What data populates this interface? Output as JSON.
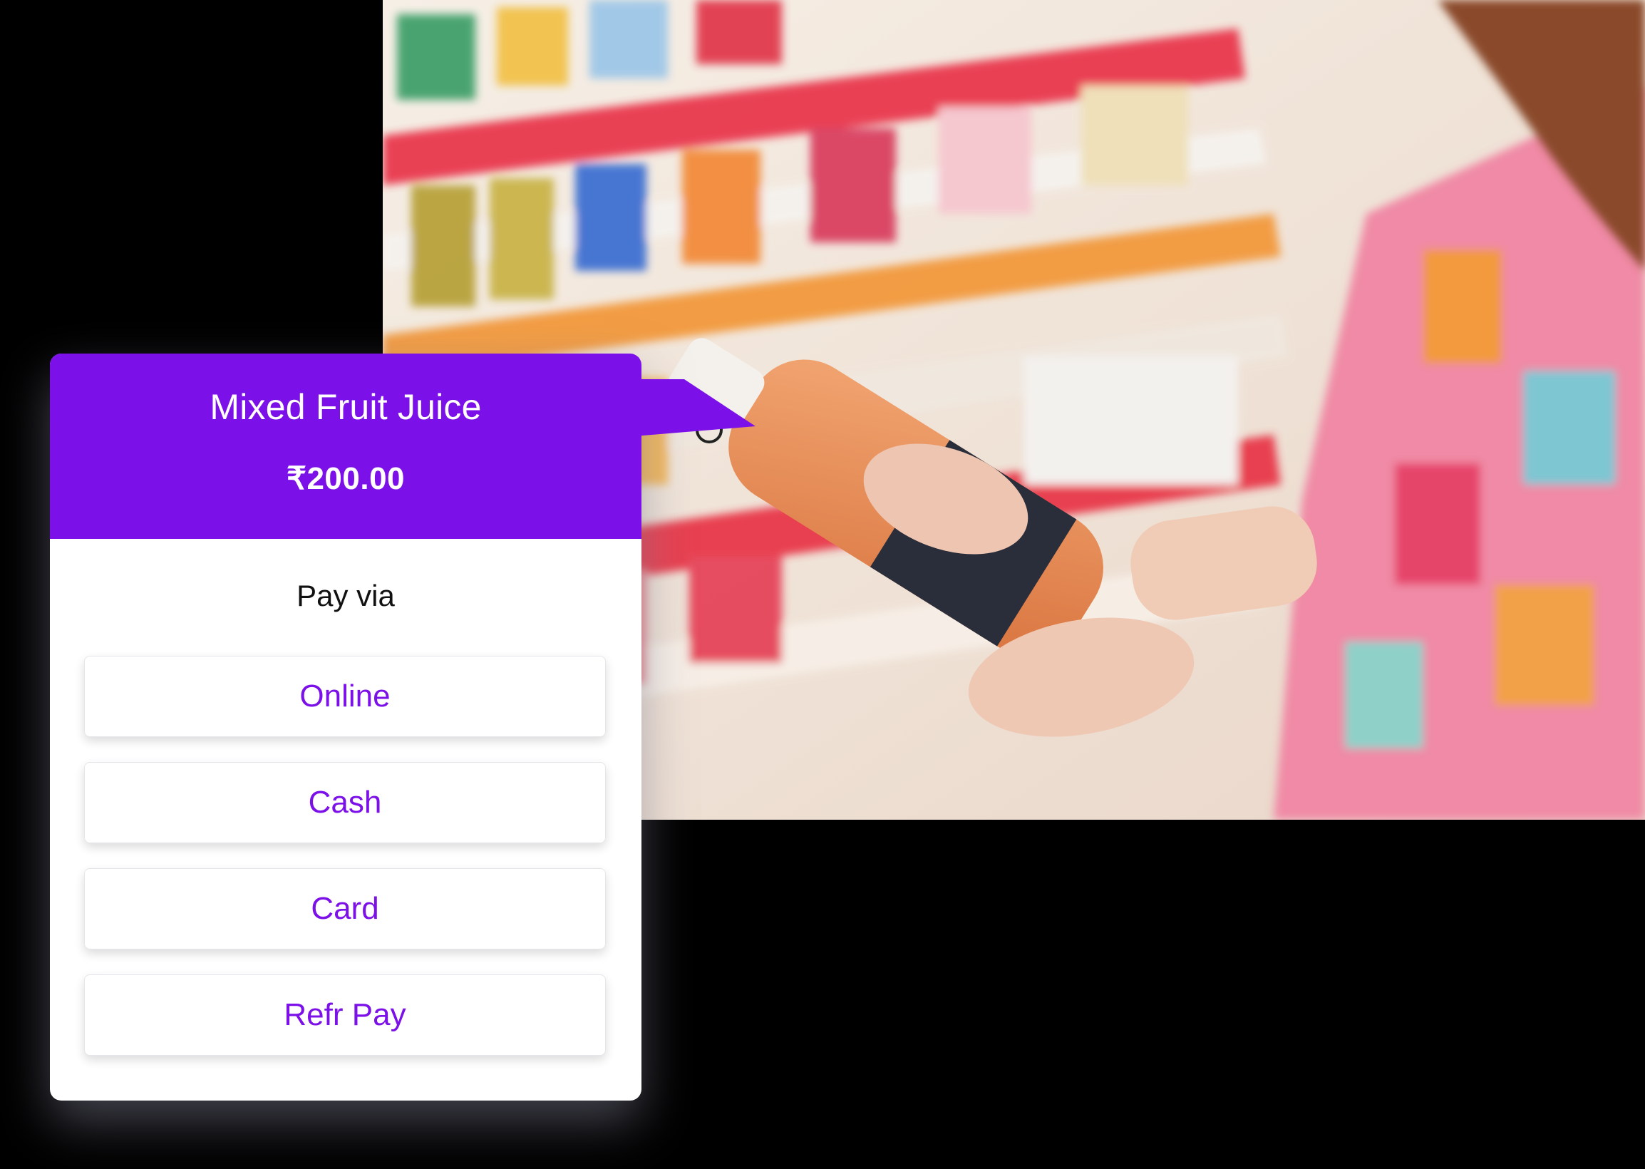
{
  "product": {
    "name": "Mixed Fruit Juice",
    "price": "₹200.00"
  },
  "payment": {
    "heading": "Pay via",
    "options": [
      {
        "label": "Online"
      },
      {
        "label": "Cash"
      },
      {
        "label": "Card"
      },
      {
        "label": "Refr Pay"
      }
    ]
  },
  "colors": {
    "accent": "#7c10e8",
    "card_background": "#ffffff",
    "page_background": "#000000"
  }
}
